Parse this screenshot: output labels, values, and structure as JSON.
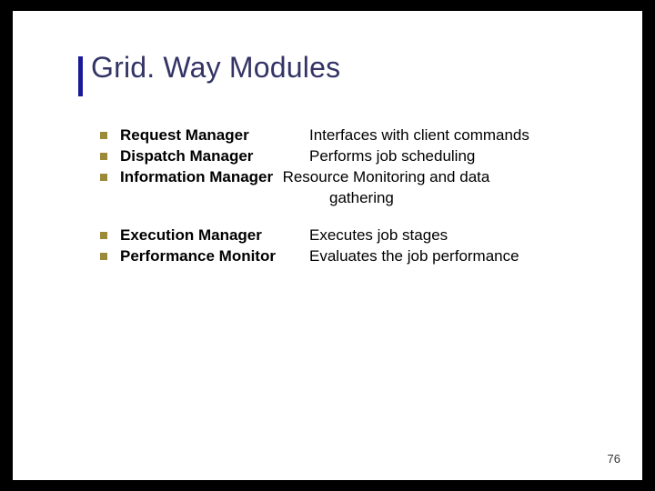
{
  "title": "Grid. Way Modules",
  "group1": [
    {
      "term": "Request Manager",
      "desc": "Interfaces with client commands"
    },
    {
      "term": "Dispatch Manager",
      "desc": "Performs job scheduling"
    },
    {
      "term": "Information Manager",
      "desc": "Resource Monitoring and data",
      "cont": "gathering"
    }
  ],
  "group2": [
    {
      "term": "Execution Manager",
      "desc": "Executes job stages"
    },
    {
      "term": "Performance Monitor",
      "desc": "Evaluates the job performance"
    }
  ],
  "page_number": "76"
}
